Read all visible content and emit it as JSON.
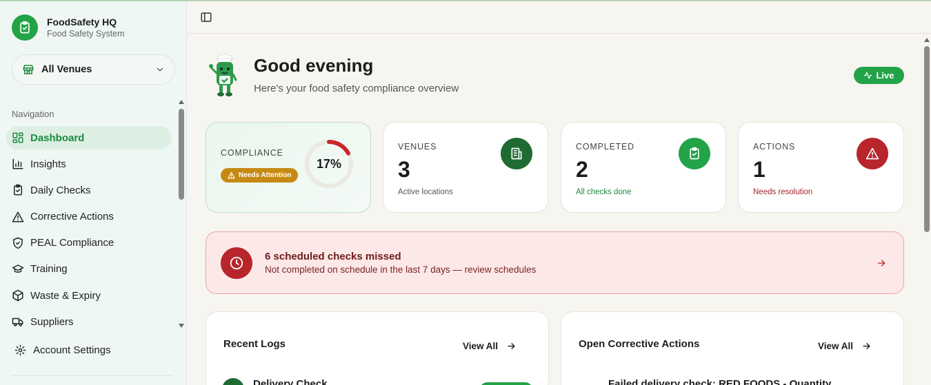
{
  "brand": {
    "title": "FoodSafety HQ",
    "subtitle": "Food Safety System"
  },
  "venue_select": {
    "label": "All Venues",
    "icon": "store-icon"
  },
  "nav": {
    "heading": "Navigation",
    "items": [
      {
        "label": "Dashboard",
        "icon": "grid-icon",
        "active": true
      },
      {
        "label": "Insights",
        "icon": "bar-chart-icon"
      },
      {
        "label": "Daily Checks",
        "icon": "clipboard-check-icon"
      },
      {
        "label": "Corrective Actions",
        "icon": "warning-icon"
      },
      {
        "label": "PEAL Compliance",
        "icon": "shield-check-icon"
      },
      {
        "label": "Training",
        "icon": "graduation-cap-icon"
      },
      {
        "label": "Waste & Expiry",
        "icon": "box-icon"
      },
      {
        "label": "Suppliers",
        "icon": "truck-icon"
      }
    ],
    "account": "Account Settings"
  },
  "header": {
    "greeting": "Good evening",
    "subtitle": "Here's your food safety compliance overview",
    "live": "Live"
  },
  "stats": {
    "compliance": {
      "label": "COMPLIANCE",
      "badge": "Needs Attention",
      "value": "17%",
      "fraction": 0.17
    },
    "venues": {
      "label": "VENUES",
      "value": "3",
      "sub": "Active locations"
    },
    "completed": {
      "label": "COMPLETED",
      "value": "2",
      "sub": "All checks done"
    },
    "actions": {
      "label": "ACTIONS",
      "value": "1",
      "sub": "Needs resolution"
    }
  },
  "alert": {
    "title": "6 scheduled checks missed",
    "subtitle": "Not completed on schedule in the last 7 days — review schedules"
  },
  "panels": {
    "recent_logs": {
      "title": "Recent Logs",
      "view_all": "View All",
      "first_row": "Delivery Check"
    },
    "open_actions": {
      "title": "Open Corrective Actions",
      "view_all": "View All",
      "first_row": "Failed delivery check: RED FOODS - Quantity"
    }
  },
  "colors": {
    "brand_green": "#22a347",
    "dark_green": "#1e6b33",
    "danger_red": "#b8252a",
    "warning_amber": "#c68a14"
  }
}
